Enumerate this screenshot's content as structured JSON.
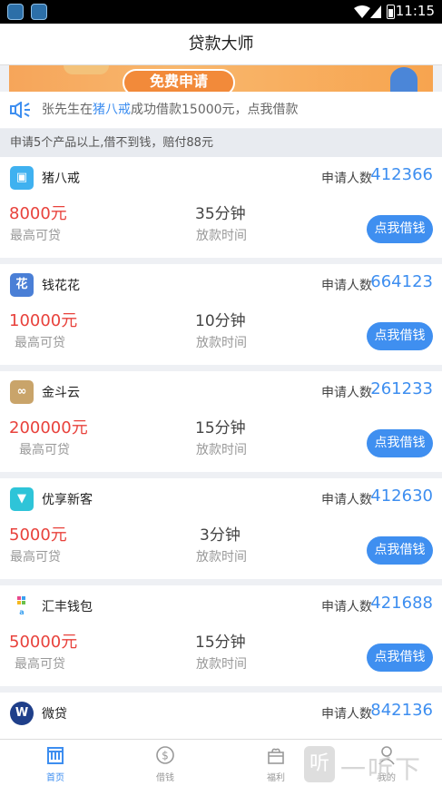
{
  "status_bar": {
    "time": "11:15",
    "app_icons": [
      "app-icon",
      "app-icon"
    ]
  },
  "title": "贷款大师",
  "banner": {
    "apply_label": "免费申请"
  },
  "notice": {
    "prefix": "张先生在",
    "highlight": "猪八戒",
    "suffix": "成功借款15000元，点我借款"
  },
  "tip": "申请5个产品以上,借不到钱，赔付88元",
  "count_label": "申请人数",
  "amount_caption": "最高可贷",
  "time_caption": "放款时间",
  "button_label": "点我借钱",
  "products": [
    {
      "name": "猪八戒",
      "count": "412366",
      "amount": "8000元",
      "time": "35分钟",
      "logo_color": "#3fb1f0",
      "logo_glyph": "▣"
    },
    {
      "name": "钱花花",
      "count": "664123",
      "amount": "10000元",
      "time": "10分钟",
      "logo_color": "#4a7fd6",
      "logo_glyph": "花"
    },
    {
      "name": "金斗云",
      "count": "261233",
      "amount": "200000元",
      "time": "15分钟",
      "logo_color": "#c9a46a",
      "logo_glyph": "∞"
    },
    {
      "name": "优享新客",
      "count": "412630",
      "amount": "5000元",
      "time": "3分钟",
      "logo_color": "#2ec4d8",
      "logo_glyph": "▼"
    },
    {
      "name": "汇丰钱包",
      "count": "421688",
      "amount": "50000元",
      "time": "15分钟",
      "logo_color": "#ffffff",
      "logo_glyph": ""
    },
    {
      "name": "微贷",
      "count": "842136",
      "amount": "",
      "time": "",
      "logo_color": "#1f3f8a",
      "logo_glyph": "W"
    }
  ],
  "tabs": [
    {
      "label": "首页",
      "icon": "home-icon",
      "active": true
    },
    {
      "label": "借钱",
      "icon": "dollar-icon",
      "active": false
    },
    {
      "label": "福利",
      "icon": "gift-icon",
      "active": false
    },
    {
      "label": "我的",
      "icon": "user-icon",
      "active": false
    }
  ],
  "watermark": {
    "glyph": "听",
    "text": "一听下载"
  },
  "colors": {
    "accent": "#3d8ef0",
    "amount": "#e8423c",
    "button": "#3f8ff0"
  }
}
